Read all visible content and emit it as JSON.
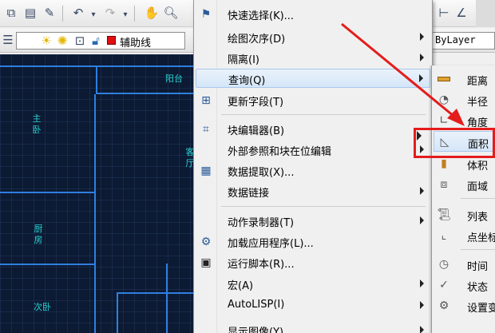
{
  "toolbar": {
    "layer_name": "辅助线",
    "linetype": "ByLayer"
  },
  "rooms": [
    {
      "name": "阳台"
    },
    {
      "name": "主卧"
    },
    {
      "name": "厨房"
    },
    {
      "name": "次卧"
    },
    {
      "name": "客厅"
    }
  ],
  "menu": {
    "items": [
      {
        "label": "快速选择(K)...",
        "icon": "quick-select-icon"
      },
      {
        "label": "绘图次序(D)",
        "submenu": true
      },
      {
        "label": "隔离(I)",
        "submenu": true
      },
      {
        "label": "查询(Q)",
        "submenu": true
      },
      {
        "label": "更新字段(T)",
        "icon": "update-field-icon"
      },
      {
        "label": "块编辑器(B)",
        "icon": "block-editor-icon"
      },
      {
        "label": "外部参照和块在位编辑",
        "submenu": true
      },
      {
        "label": "数据提取(X)...",
        "icon": "data-extract-icon"
      },
      {
        "label": "数据链接",
        "submenu": true
      },
      {
        "label": "动作录制器(T)",
        "submenu": true
      },
      {
        "label": "加载应用程序(L)...",
        "icon": "load-app-icon"
      },
      {
        "label": "运行脚本(R)...",
        "icon": "run-script-icon"
      },
      {
        "label": "宏(A)",
        "submenu": true
      },
      {
        "label": "AutoLISP(I)",
        "submenu": true
      },
      {
        "label": "显示图像(Y)",
        "submenu": true
      }
    ]
  },
  "submenu": {
    "items": [
      {
        "label": "距离",
        "icon": "distance-icon"
      },
      {
        "label": "半径",
        "icon": "radius-icon"
      },
      {
        "label": "角度",
        "icon": "angle-icon"
      },
      {
        "label": "面积",
        "icon": "area-icon"
      },
      {
        "label": "体积",
        "icon": "volume-icon"
      },
      {
        "label": "面域",
        "icon": "region-icon"
      },
      {
        "label": "列表",
        "icon": "list-icon"
      },
      {
        "label": "点坐标",
        "icon": "point-icon"
      },
      {
        "label": "时间",
        "icon": "clock-icon"
      },
      {
        "label": "状态",
        "icon": "status-icon"
      },
      {
        "label": "设置变量",
        "icon": "gear-icon"
      }
    ]
  },
  "colors": {
    "canvas_bg": "#0c1a33",
    "wall": "#2e7fe0",
    "room_label": "#29d3d3",
    "annotation": "#e41c1c",
    "highlight": "#d5e6f8"
  }
}
